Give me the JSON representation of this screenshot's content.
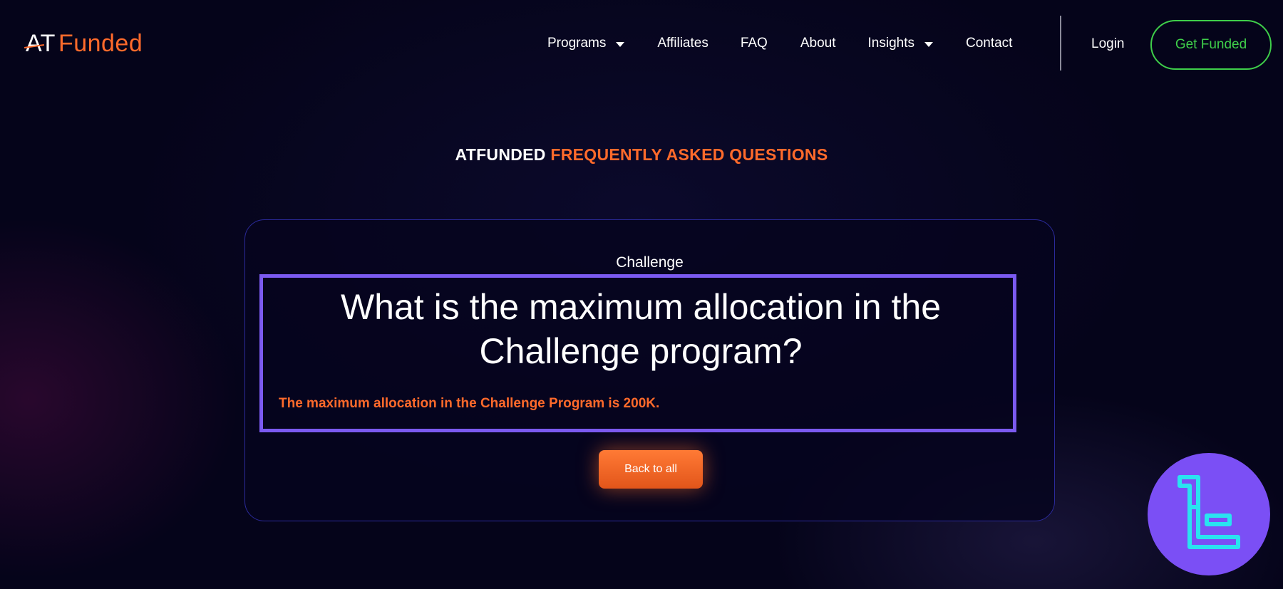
{
  "header": {
    "logo": {
      "part1": "AT",
      "part2": "Funded"
    },
    "nav": [
      {
        "label": "Programs",
        "has_dropdown": true
      },
      {
        "label": "Affiliates",
        "has_dropdown": false
      },
      {
        "label": "FAQ",
        "has_dropdown": false
      },
      {
        "label": "About",
        "has_dropdown": false
      },
      {
        "label": "Insights",
        "has_dropdown": true
      },
      {
        "label": "Contact",
        "has_dropdown": false
      }
    ],
    "login_label": "Login",
    "cta_label": "Get Funded"
  },
  "section": {
    "heading_part1": "ATFUNDED",
    "heading_part2": "FREQUENTLY ASKED QUESTIONS"
  },
  "faq": {
    "category": "Challenge",
    "question": "What is the maximum allocation in the Challenge program?",
    "answer": "The maximum allocation in the Challenge Program is 200K.",
    "back_label": "Back to all"
  },
  "colors": {
    "accent_orange": "#ff6a2b",
    "cta_green": "#3fcf4a",
    "highlight_purple": "#7b5af0",
    "background": "#05041a",
    "badge_purple": "#7b4ff5",
    "badge_glyph": "#29e3f0"
  },
  "icons": {
    "dropdown": "chevron-down-icon",
    "watermark": "tradingfinder-logo-icon"
  }
}
